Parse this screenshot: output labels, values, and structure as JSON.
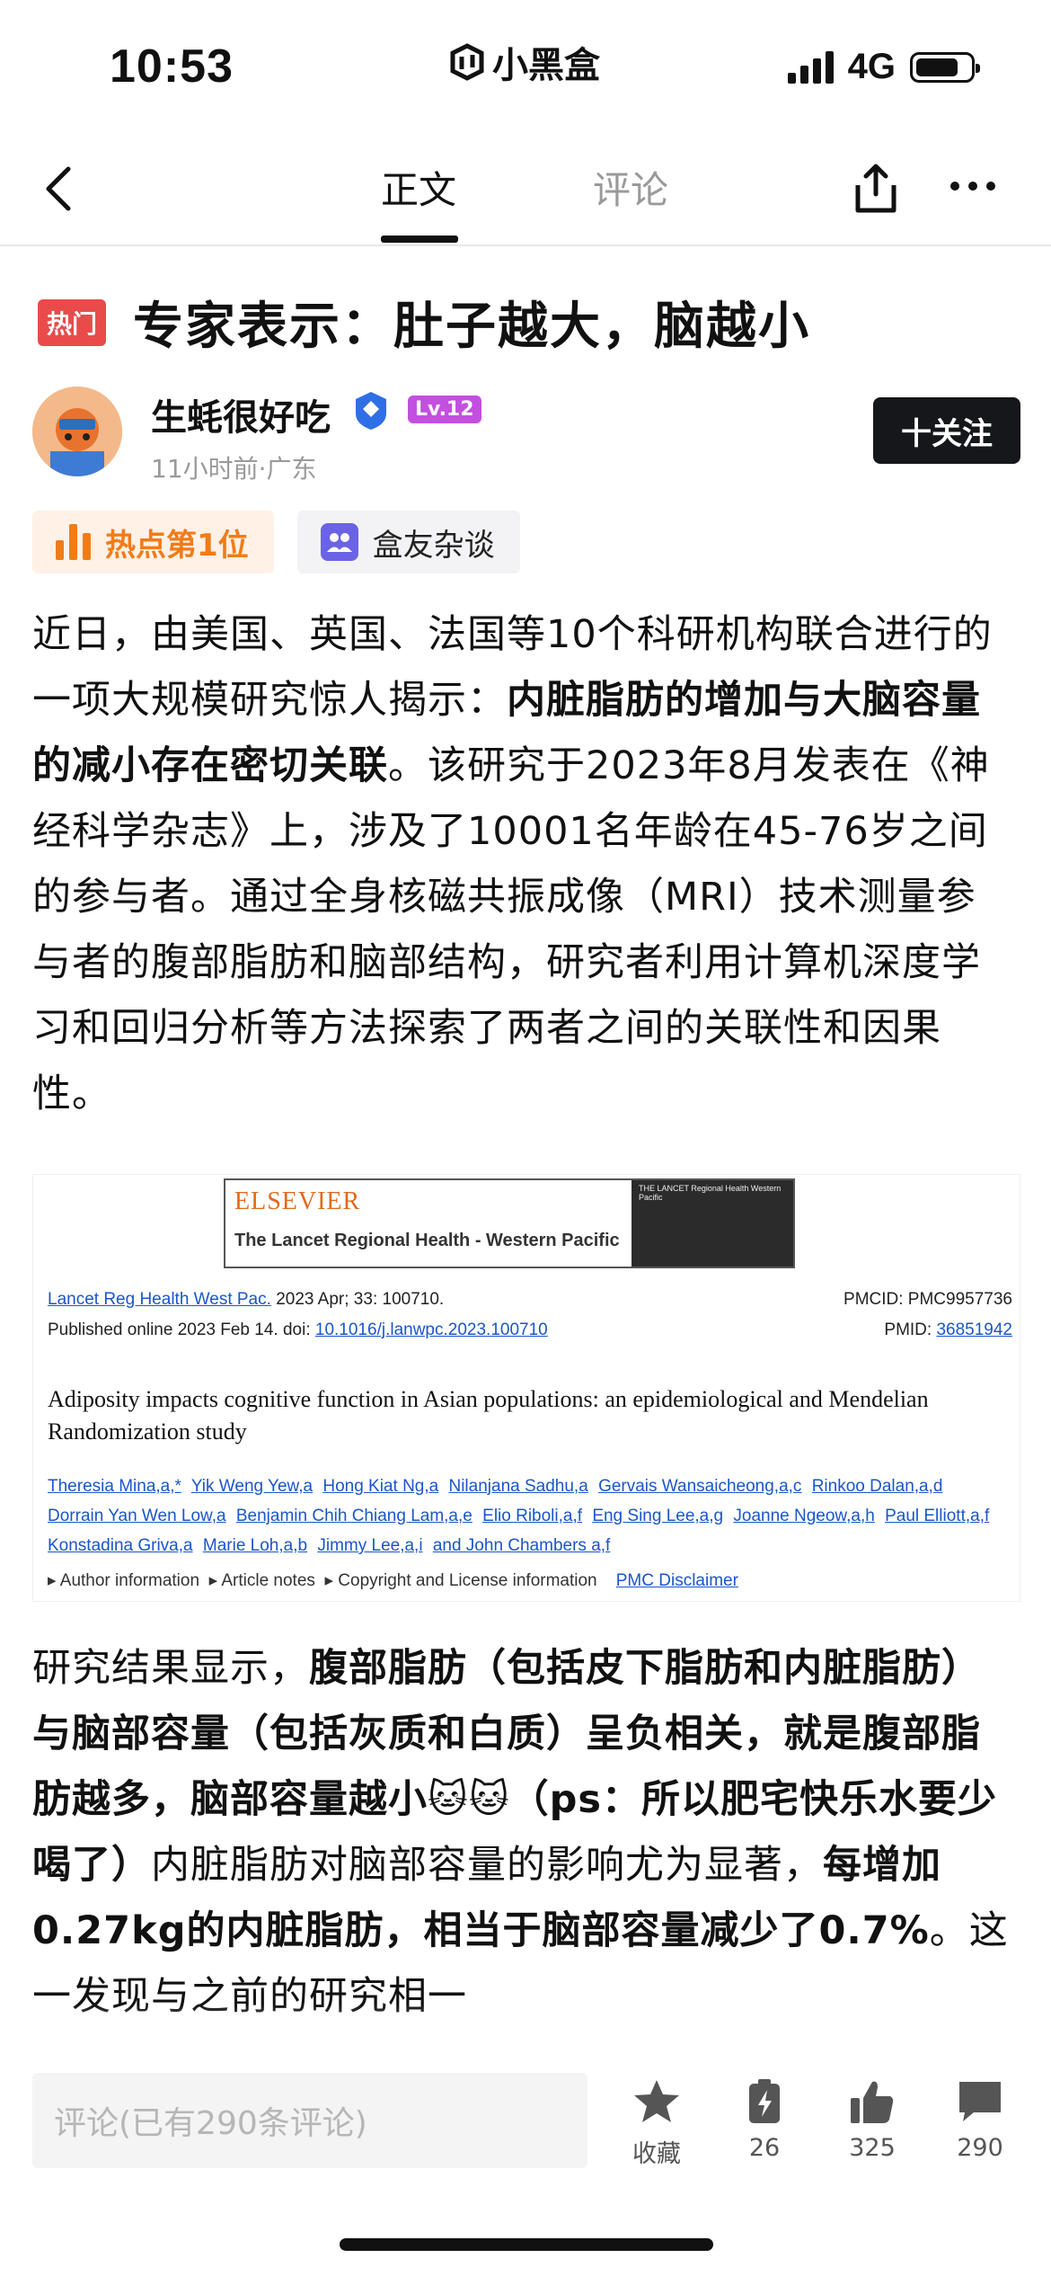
{
  "status_bar": {
    "time": "10:53",
    "app_name": "小黑盒",
    "network": "4G",
    "icons": [
      "signal-icon",
      "battery-icon"
    ]
  },
  "nav": {
    "tabs": [
      {
        "label": "正文",
        "active": true
      },
      {
        "label": "评论",
        "active": false
      }
    ],
    "icons": [
      "back-icon",
      "share-icon",
      "more-icon"
    ]
  },
  "article": {
    "hot_badge": "热门",
    "title": "专家表示：肚子越大，脑越小",
    "author": {
      "name": "生蚝很好吃",
      "level": "Lv.12",
      "meta": "11小时前·广东",
      "follow_label": "十关注"
    },
    "tags": [
      {
        "label": "热点第1位",
        "icon": "bar-chart-icon"
      },
      {
        "label": "盒友杂谈",
        "icon": "group-icon"
      }
    ],
    "paragraph1": [
      {
        "text": "近日，由美国、英国、法国等10个科研机构联合进行的一项大规模研究惊人揭示：",
        "bold": false
      },
      {
        "text": "内脏脂肪的增加与大脑容量的减小存在密切关联",
        "bold": true
      },
      {
        "text": "。该研究于2023年8月发表在《神经科学杂志》上，涉及了10001名年龄在45-76岁之间的参与者。通过全身核磁共振成像（MRI）技术测量参与者的腹部脂肪和脑部结构，研究者利用计算机深度学习和回归分析等方法探索了两者之间的关联性和因果性。",
        "bold": false
      }
    ],
    "figure": {
      "publisher": "ELSEVIER",
      "journal": "The Lancet Regional Health - Western Pacific",
      "journal_logo_text": "THE LANCET Regional Health Western Pacific",
      "citation_link": "Lancet Reg Health West Pac.",
      "citation_rest": "2023 Apr; 33: 100710.",
      "pmcid": "PMCID: PMC9957736",
      "published_prefix": "Published online 2023 Feb 14. doi:",
      "doi": "10.1016/j.lanwpc.2023.100710",
      "pmid_label": "PMID:",
      "pmid": "36851942",
      "paper_title": "Adiposity impacts cognitive function in Asian populations: an epidemiological and Mendelian Randomization study",
      "authors": [
        "Theresia Mina,a,*",
        "Yik Weng Yew,a",
        "Hong Kiat Ng,a",
        "Nilanjana Sadhu,a",
        "Gervais Wansaicheong,a,c",
        "Rinkoo Dalan,a,d",
        "Dorrain Yan Wen Low,a",
        "Benjamin Chih Chiang Lam,a,e",
        "Elio Riboli,a,f",
        "Eng Sing Lee,a,g",
        "Joanne Ngeow,a,h",
        "Paul Elliott,a,f",
        "Konstadina Griva,a",
        "Marie Loh,a,b",
        "Jimmy Lee,a,i",
        "and John Chambers a,f"
      ],
      "footer_items": [
        "▸ Author information",
        "▸ Article notes",
        "▸ Copyright and License information",
        "PMC Disclaimer"
      ]
    },
    "paragraph2": [
      {
        "text": "研究结果显示，",
        "bold": false
      },
      {
        "text": "腹部脂肪（包括皮下脂肪和内脏脂肪）与脑部容量（包括灰质和白质）呈负相关，就是腹部脂肪越多，脑部容量越小",
        "bold": true
      },
      {
        "text": "🐱🐱",
        "bold": false
      },
      {
        "text": "（ps：所以肥宅快乐水要少喝了）",
        "bold": true
      },
      {
        "text": "内脏脂肪对脑部容量的影响尤为显著，",
        "bold": false
      },
      {
        "text": "每增加0.27kg的内脏脂肪，相当于脑部容量减少了0.7%",
        "bold": true
      },
      {
        "text": "。这一发现与之前的研究相一",
        "bold": false
      }
    ]
  },
  "bottom_bar": {
    "comment_placeholder": "评论(已有290条评论)",
    "actions": [
      {
        "label": "收藏",
        "icon": "star-icon"
      },
      {
        "label": "26",
        "icon": "charge-icon"
      },
      {
        "label": "325",
        "icon": "thumbs-up-icon"
      },
      {
        "label": "290",
        "icon": "comment-icon"
      }
    ]
  }
}
